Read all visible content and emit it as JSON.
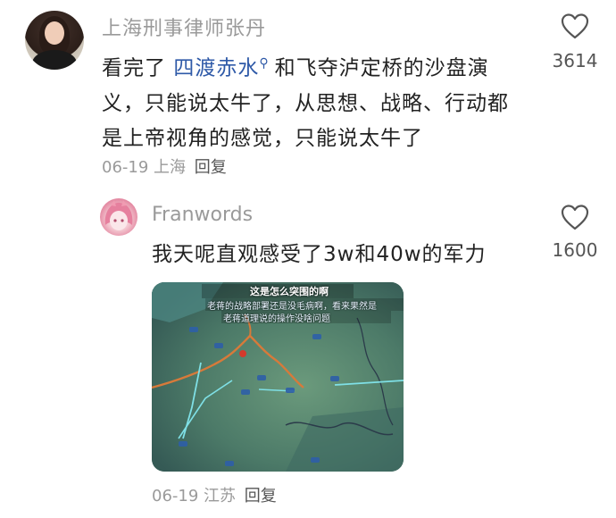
{
  "comment": {
    "author": "上海刑事律师张丹",
    "text_before_link": "看完了 ",
    "link_text": "四渡赤水",
    "text_after_link": "和飞夺泸定桥的沙盘演义，只能说太牛了，从思想、战略、行动都是上帝视角的感觉，只能说太牛了",
    "date": "06-19",
    "location": "上海",
    "reply_label": "回复",
    "like_count": "3614"
  },
  "reply": {
    "author": "Franwords",
    "text": "我天呢直观感受了3w和40w的军力",
    "date": "06-19",
    "location": "江苏",
    "reply_label": "回复",
    "like_count": "1600",
    "image_captions": {
      "line1": "这是怎么突围的啊",
      "line2": "老蒋的战略部署还是没毛病啊，看来果然是",
      "line3": "老蒋道理说的操作没啥问题"
    }
  },
  "colors": {
    "meta_gray": "#9a9a9a",
    "link_blue": "#2f5aa8",
    "map_green": "#4a7d74",
    "route_orange": "#d77a3a",
    "route_cyan": "#7fe0e6"
  }
}
